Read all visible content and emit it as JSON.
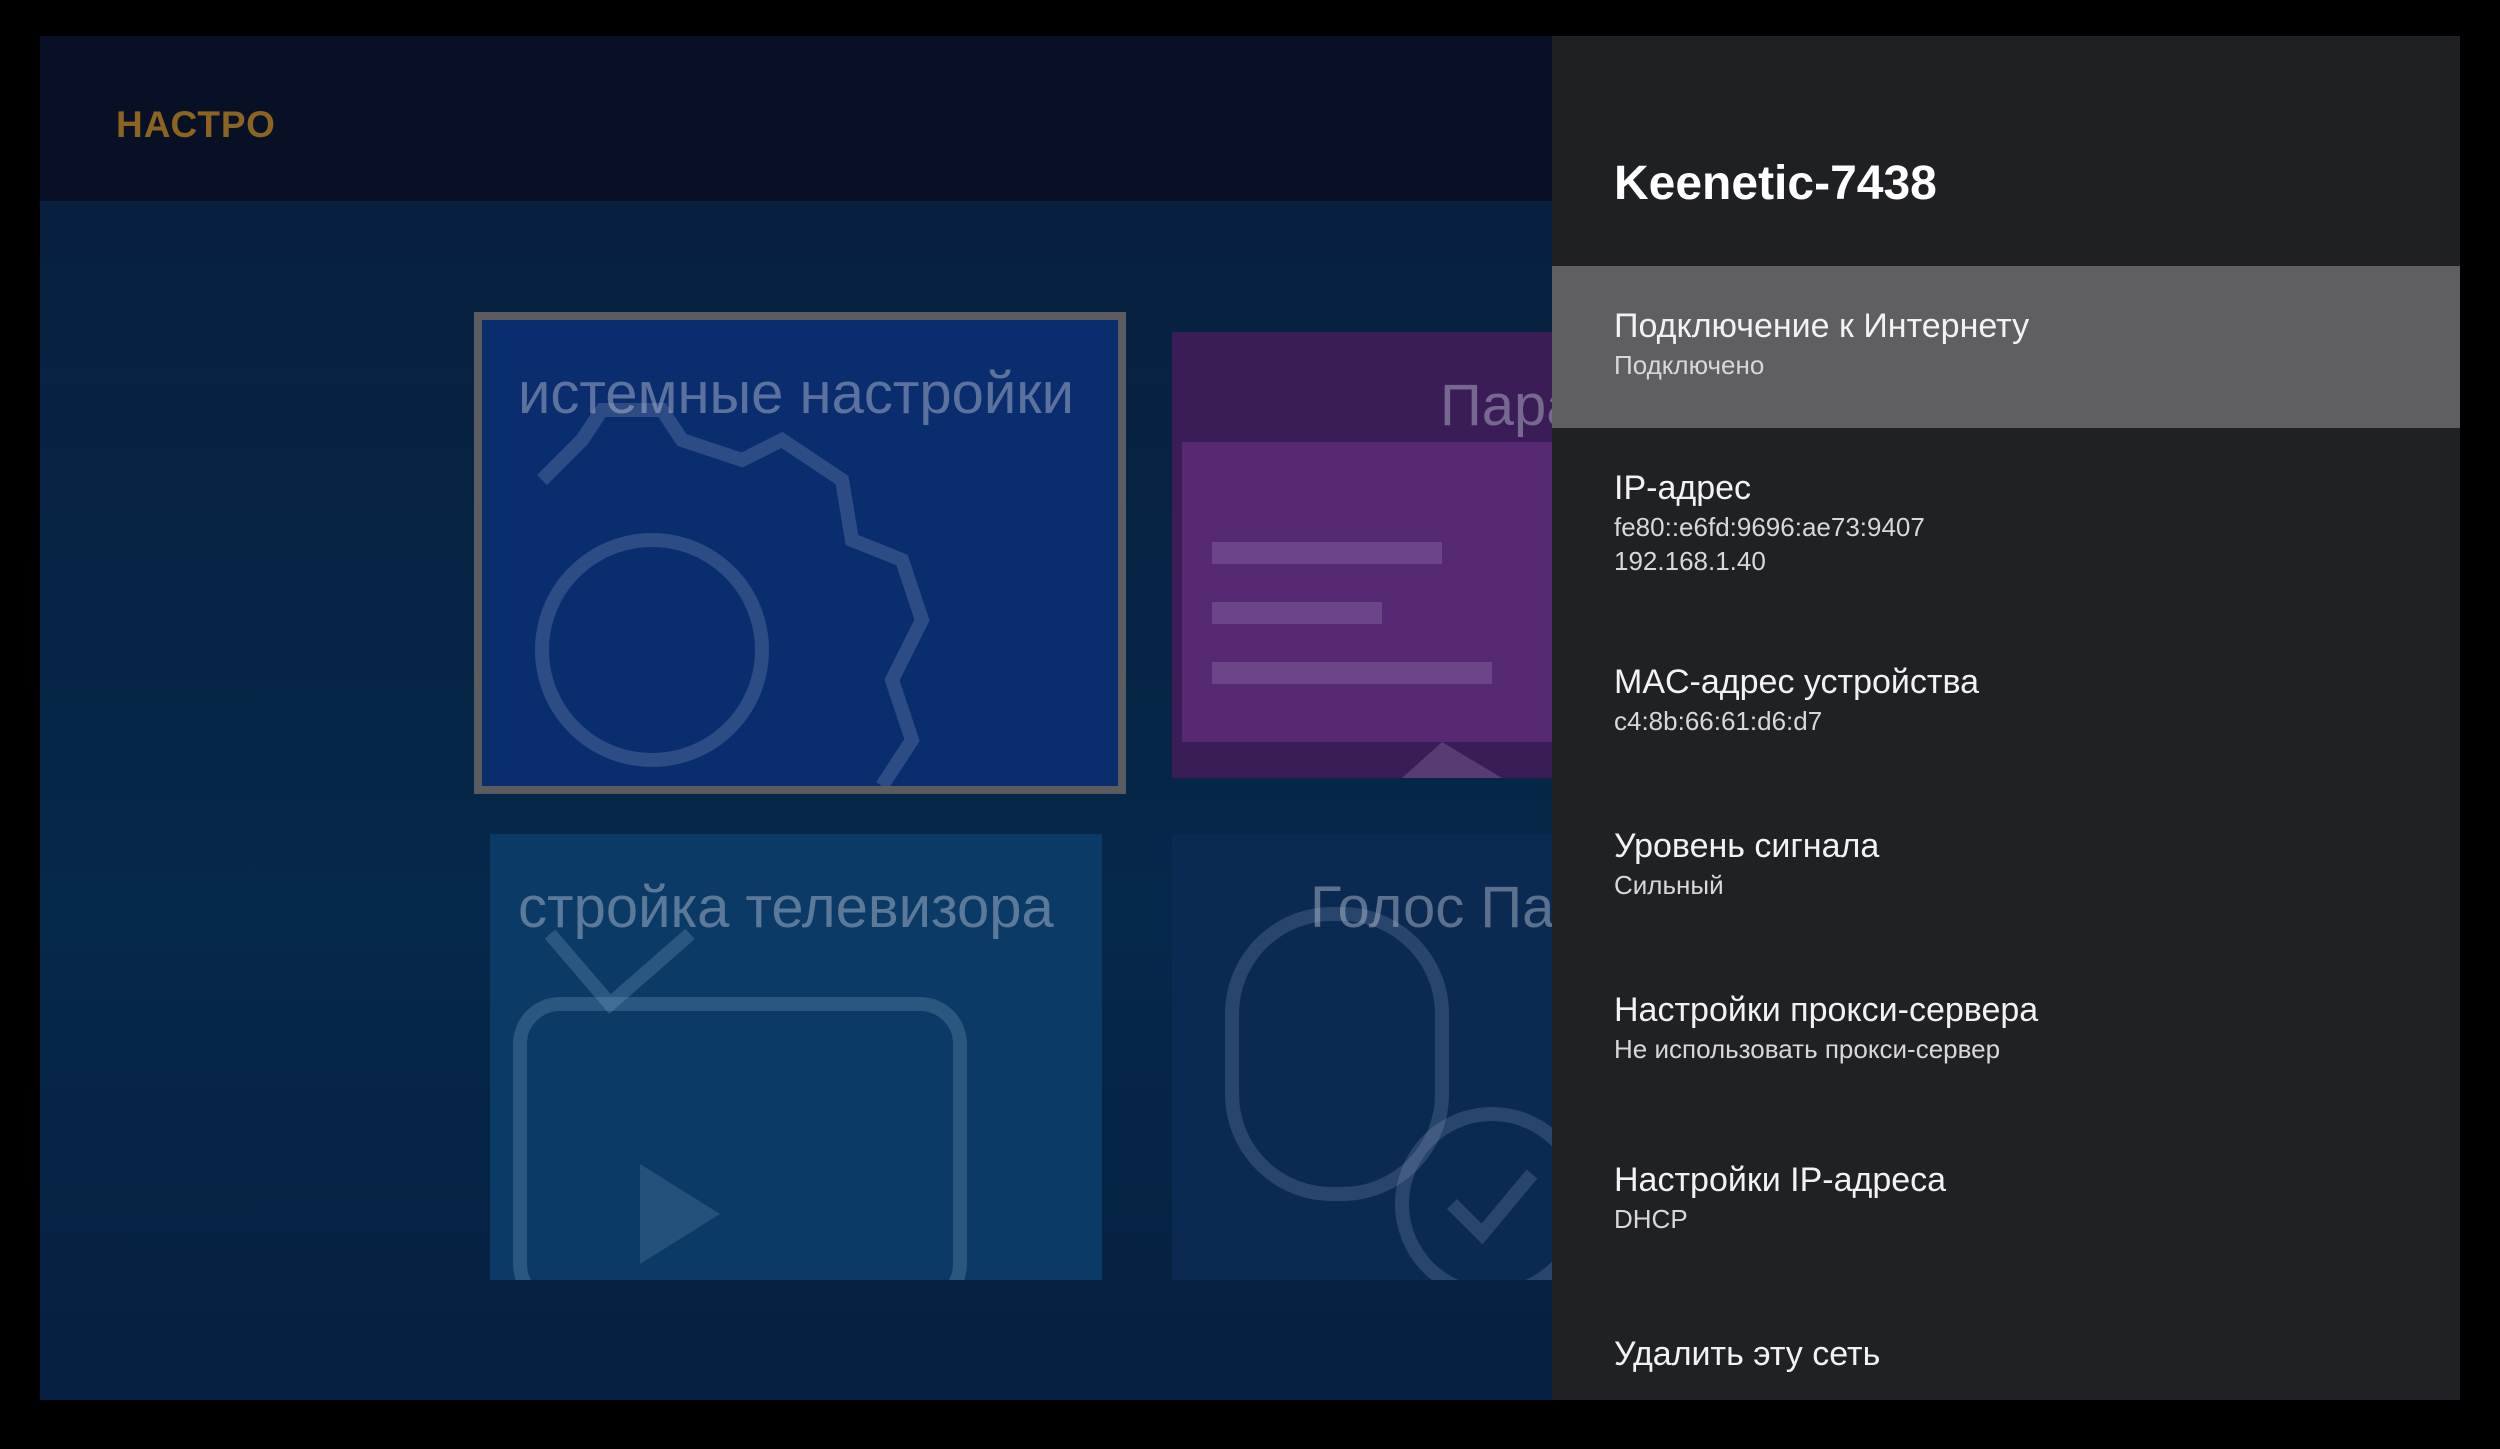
{
  "background": {
    "page_title": "НАСТРО",
    "tiles": {
      "system": "истемные настройки",
      "params": "Пара",
      "tv": "стройка телевизора",
      "voice": "Голос Па"
    }
  },
  "panel": {
    "network_name": "Keenetic-7438",
    "items": [
      {
        "title": "Подключение к Интернету",
        "subtitle": "Подключено"
      },
      {
        "title": "IP-адрес",
        "subtitle": "fe80::e6fd:9696:ae73:9407",
        "subtitle2": "192.168.1.40"
      },
      {
        "title": "MAC-адрес устройства",
        "subtitle": "c4:8b:66:61:d6:d7"
      },
      {
        "title": "Уровень сигнала",
        "subtitle": "Сильный"
      },
      {
        "title": "Настройки прокси-сервера",
        "subtitle": "Не использовать прокси-сервер"
      },
      {
        "title": "Настройки IP-адреса",
        "subtitle": "DHCP"
      },
      {
        "title": "Удалить эту сеть"
      }
    ]
  },
  "colors": {
    "panel_bg": "#202124",
    "selected_bg": "#5f5f63",
    "page_title": "#8a6420"
  }
}
